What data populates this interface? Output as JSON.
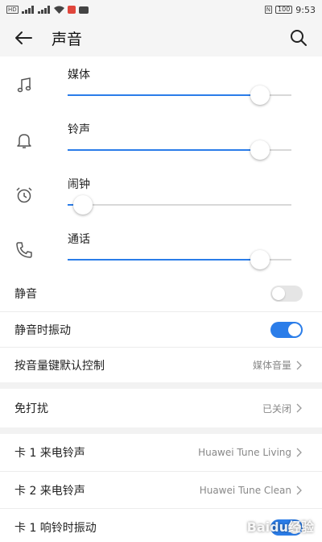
{
  "status_bar": {
    "time": "9:53",
    "battery_level": "100"
  },
  "header": {
    "title": "声音"
  },
  "volumes": [
    {
      "label": "媒体",
      "level": 0.86,
      "icon": "music-note-icon"
    },
    {
      "label": "铃声",
      "level": 0.86,
      "icon": "bell-icon"
    },
    {
      "label": "闹钟",
      "level": 0.07,
      "icon": "alarm-clock-icon"
    },
    {
      "label": "通话",
      "level": 0.86,
      "icon": "phone-icon"
    }
  ],
  "toggles": {
    "mute_label": "静音",
    "mute_on": false,
    "vibrate_on_mute_label": "静音时振动",
    "vibrate_on_mute_on": true
  },
  "volume_key": {
    "label": "按音量键默认控制",
    "value": "媒体音量"
  },
  "dnd": {
    "label": "免打扰",
    "value": "已关闭"
  },
  "ringtones": {
    "sim1_label": "卡 1 来电铃声",
    "sim1_value": "Huawei Tune Living",
    "sim2_label": "卡 2 来电铃声",
    "sim2_value": "Huawei Tune Clean",
    "sim1_vibrate_label": "卡 1 响铃时振动",
    "sim1_vibrate_on": true
  },
  "watermark": "Baidu经验",
  "colors": {
    "accent": "#2b7de9",
    "background": "#f2f2f2"
  }
}
